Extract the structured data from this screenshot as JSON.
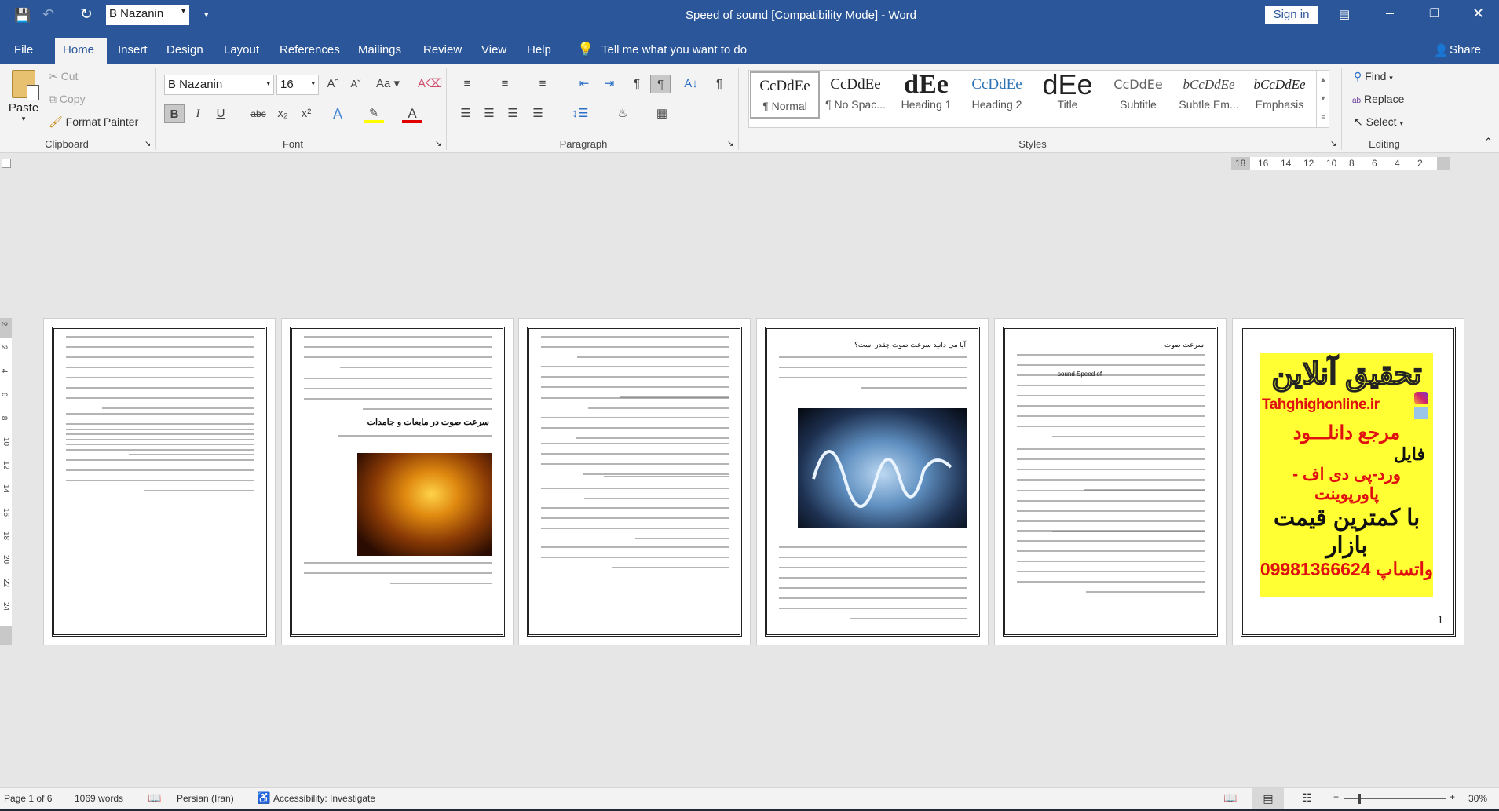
{
  "titlebar": {
    "font_value": "B Nazanin",
    "title": "Speed of sound [Compatibility Mode]  -  Word",
    "sign_in": "Sign in",
    "accent": "#2b579a"
  },
  "tabs": [
    {
      "label": "File"
    },
    {
      "label": "Home"
    },
    {
      "label": "Insert"
    },
    {
      "label": "Design"
    },
    {
      "label": "Layout"
    },
    {
      "label": "References"
    },
    {
      "label": "Mailings"
    },
    {
      "label": "Review"
    },
    {
      "label": "View"
    },
    {
      "label": "Help"
    }
  ],
  "tell_me": "Tell me what you want to do",
  "share": "Share",
  "clipboard": {
    "paste": "Paste",
    "cut": "Cut",
    "copy": "Copy",
    "format_painter": "Format Painter",
    "label": "Clipboard"
  },
  "font": {
    "name": "B Nazanin",
    "size": "16",
    "label": "Font",
    "bold": "B",
    "italic": "I",
    "underline": "U",
    "strike": "abc",
    "sub": "x₂",
    "sup": "x²",
    "case": "Aa"
  },
  "paragraph": {
    "label": "Paragraph"
  },
  "styles": {
    "label": "Styles",
    "items": [
      {
        "preview": "CcDdEe",
        "name": "¶ Normal"
      },
      {
        "preview": "CcDdEe",
        "name": "¶ No Spac..."
      },
      {
        "preview": "dEe",
        "name": "Heading 1"
      },
      {
        "preview": "CcDdEe",
        "name": "Heading 2"
      },
      {
        "preview": "dEe",
        "name": "Title"
      },
      {
        "preview": "CcDdEe",
        "name": "Subtitle"
      },
      {
        "preview": "bCcDdEe",
        "name": "Subtle Em..."
      },
      {
        "preview": "bCcDdEe",
        "name": "Emphasis"
      }
    ]
  },
  "editing": {
    "find": "Find",
    "replace": "Replace",
    "select": "Select",
    "label": "Editing"
  },
  "ruler": {
    "h": [
      "18",
      "16",
      "14",
      "12",
      "10",
      "8",
      "6",
      "4",
      "2"
    ],
    "v": [
      "2",
      "2",
      "4",
      "6",
      "8",
      "10",
      "12",
      "14",
      "16",
      "18",
      "20",
      "22",
      "24"
    ]
  },
  "pages": {
    "p2_heading": "سرعت صوت در مایعات و جامدات",
    "p5_heading": "آیا می دانید سرعت صوت چقدر است؟",
    "p6_heading": "سرعت صوت",
    "p6_inline": "sound Speed of"
  },
  "ad": {
    "title": "تحقیق آنلاین",
    "site": "Tahghighonline.ir",
    "line1": "مرجع دانلـــود",
    "line2": "فایل",
    "line3": "ورد-پی دی اف - پاورپوینت",
    "line4": "با کمترین قیمت بازار",
    "phone": "09981366624",
    "whatsapp": "واتساپ",
    "page_number": "1",
    "bg": "#ffff33"
  },
  "status": {
    "page": "Page 1 of 6",
    "words": "1069 words",
    "language": "Persian (Iran)",
    "accessibility": "Accessibility: Investigate",
    "zoom": "30%"
  }
}
